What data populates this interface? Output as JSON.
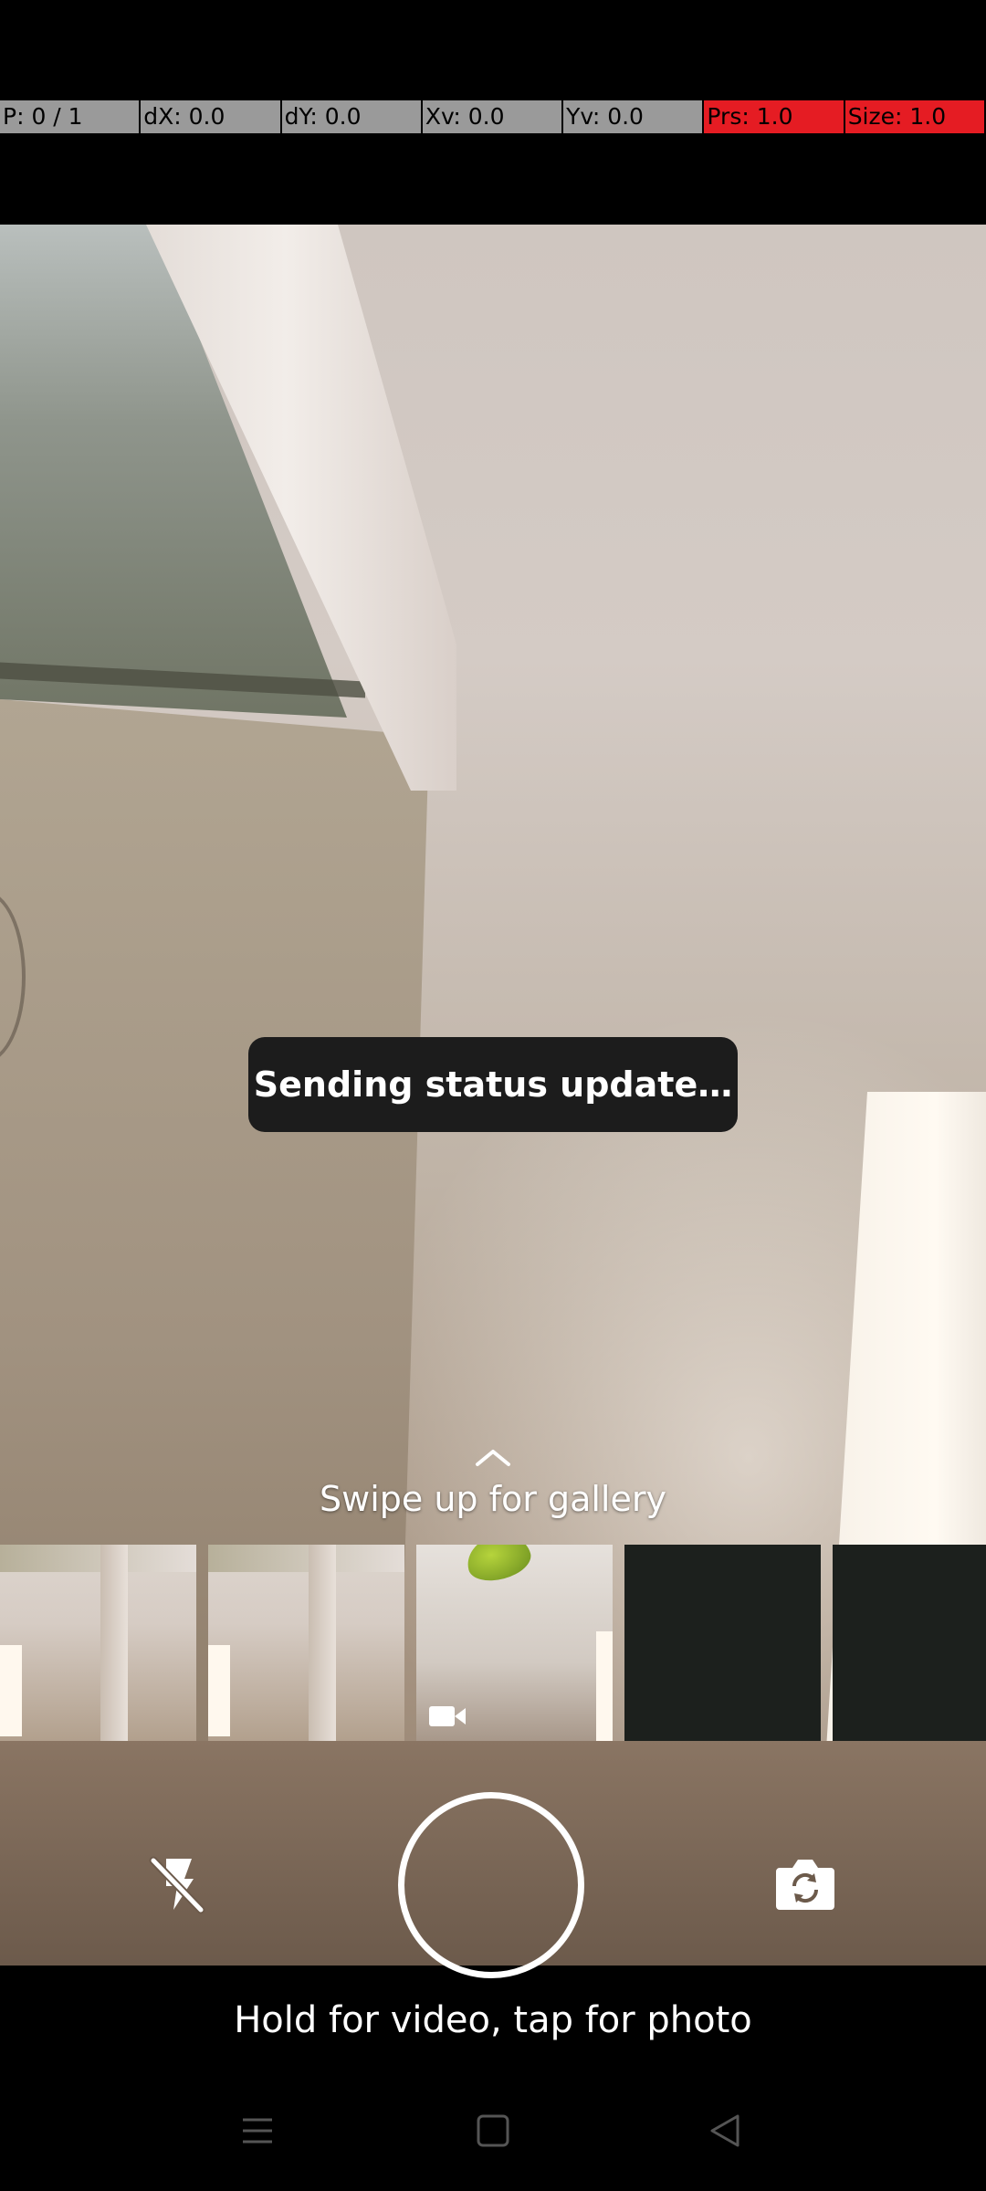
{
  "debug_overlay": {
    "pointer": "P: 0 / 1",
    "dx": "dX: 0.0",
    "dy": "dY: 0.0",
    "xv": "Xv: 0.0",
    "yv": "Yv: 0.0",
    "prs": "Prs: 1.0",
    "size": "Size: 1.0"
  },
  "toast": {
    "text": "Sending status update…"
  },
  "gallery_hint": {
    "icon": "chevron-up-icon",
    "text": "Swipe up for gallery"
  },
  "gallery": {
    "thumbnails": [
      {
        "kind": "photo"
      },
      {
        "kind": "photo"
      },
      {
        "kind": "video",
        "badge_icon": "video-camera-icon"
      },
      {
        "kind": "photo"
      },
      {
        "kind": "photo"
      }
    ]
  },
  "controls": {
    "flash_icon": "flash-off-icon",
    "shutter_icon": "shutter-icon",
    "switch_icon": "switch-camera-icon",
    "hint": "Hold for video, tap for photo"
  },
  "navigation": {
    "menu_icon": "menu-icon",
    "home_icon": "home-icon",
    "back_icon": "back-icon"
  },
  "colors": {
    "debug_gray": "#9a9a9a",
    "debug_red": "#e51c23",
    "toast_bg": "#1c1c1c"
  }
}
